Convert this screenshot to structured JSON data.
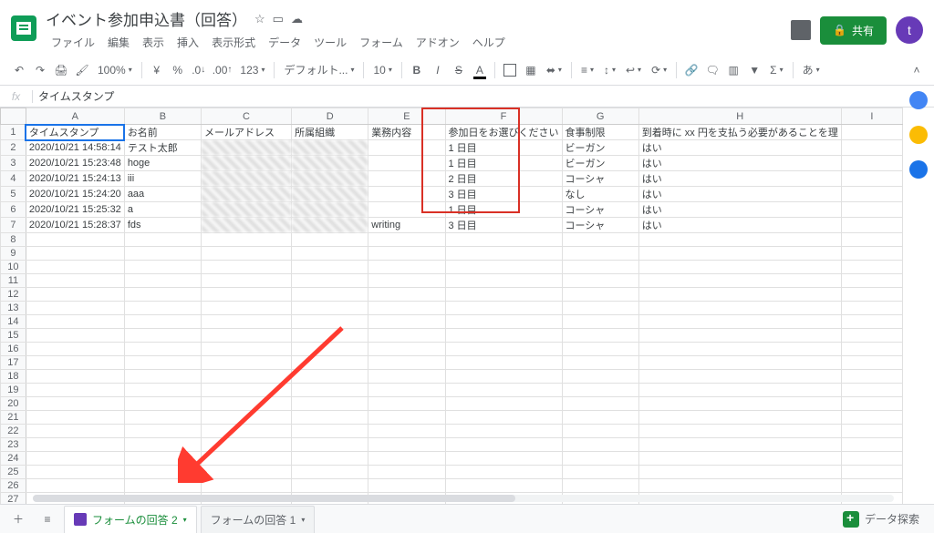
{
  "doc": {
    "title": "イベント参加申込書（回答）"
  },
  "menus": [
    "ファイル",
    "編集",
    "表示",
    "挿入",
    "表示形式",
    "データ",
    "ツール",
    "フォーム",
    "アドオン",
    "ヘルプ"
  ],
  "toolbar": {
    "zoom": "100%",
    "currency1": "¥",
    "currency2": "%",
    "dec_dec": ".0",
    "dec_inc": ".00",
    "num_fmt": "123",
    "font": "デフォルト...",
    "size": "10",
    "b": "B",
    "i": "I",
    "s": "S",
    "a": "A",
    "ime": "あ"
  },
  "share_label": "共有",
  "avatar_letter": "t",
  "fx": {
    "label": "fx",
    "value": "タイムスタンプ"
  },
  "columns": [
    "A",
    "B",
    "C",
    "D",
    "E",
    "F",
    "G",
    "H",
    "I"
  ],
  "headers": {
    "A": "タイムスタンプ",
    "B": "お名前",
    "C": "メールアドレス",
    "D": "所属組織",
    "E": "業務内容",
    "F": "参加日をお選びください",
    "G": "食事制限",
    "H": "到着時に xx 円を支払う必要があることを理",
    "I": ""
  },
  "rows": [
    {
      "A": "2020/10/21 14:58:14",
      "B": "テスト太郎",
      "C": "",
      "D": "",
      "E": "",
      "F": "1 日目",
      "G": "ビーガン",
      "H": "はい"
    },
    {
      "A": "2020/10/21 15:23:48",
      "B": "hoge",
      "C": "",
      "D": "",
      "E": "",
      "F": "1 日目",
      "G": "ビーガン",
      "H": "はい"
    },
    {
      "A": "2020/10/21 15:24:13",
      "B": "iii",
      "C": "",
      "D": "",
      "E": "",
      "F": "2 日目",
      "G": "コーシャ",
      "H": "はい"
    },
    {
      "A": "2020/10/21 15:24:20",
      "B": "aaa",
      "C": "",
      "D": "",
      "E": "",
      "F": "3 日目",
      "G": "なし",
      "H": "はい"
    },
    {
      "A": "2020/10/21 15:25:32",
      "B": "a",
      "C": "",
      "D": "",
      "E": "",
      "F": "1 日目",
      "G": "コーシャ",
      "H": "はい"
    },
    {
      "A": "2020/10/21 15:28:37",
      "B": "fds",
      "C": "",
      "D": "",
      "E": "writing",
      "F": "3 日目",
      "G": "コーシャ",
      "H": "はい"
    }
  ],
  "tabs": {
    "active": "フォームの回答 2",
    "inactive": "フォームの回答 1"
  },
  "explore": "データ探索"
}
